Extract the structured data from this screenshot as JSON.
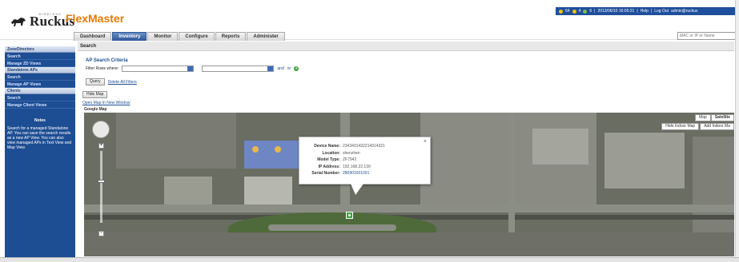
{
  "header": {
    "logo_text": "Ruckus",
    "logo_sub": "WIRELESS",
    "app_title": "FlexMaster",
    "status": {
      "counts": [
        "64",
        "4",
        "6"
      ],
      "datetime": "2013/06/10 16:05:21",
      "help": "Help",
      "logout": "Log Out",
      "user": "admin@ruckus"
    },
    "search_placeholder": "MAC or IP or Name"
  },
  "tabs": [
    {
      "label": "Dashboard"
    },
    {
      "label": "Inventory"
    },
    {
      "label": "Monitor"
    },
    {
      "label": "Configure"
    },
    {
      "label": "Reports"
    },
    {
      "label": "Administer"
    }
  ],
  "sidebar": {
    "sections": [
      {
        "title": "ZoneDirectors",
        "items": [
          "Search",
          "Manage ZD Views"
        ]
      },
      {
        "title": "Standalone APs",
        "items": [
          "Search",
          "Manage AP Views"
        ]
      },
      {
        "title": "Clients",
        "items": [
          "Search",
          "Manage Client Views"
        ]
      }
    ],
    "notes_title": "Notes",
    "notes_text": "Search for a managed Standalone AP. You can save the search results as a new AP View. You can also view managed APs in Text View and Map View."
  },
  "main": {
    "section_title": "Search",
    "criteria_title": "AP Search Criteria",
    "filter_label": "Filter Rows where:",
    "and_label": "and",
    "or_label": "or",
    "add_icon_label": "+",
    "query_button": "Query",
    "clear_filters_link": "Delete All Filters",
    "hide_map_button": "Hide Map",
    "open_map_link": "Open Map In New Window",
    "google_map_label": "Google Map"
  },
  "map": {
    "map_button": "Map",
    "satellite_button": "Satellite",
    "hide_indoor": "Hide Indoor Map",
    "add_indoor": "Add Indoor Ma",
    "zoom_in": "+",
    "zoom_out": "-",
    "close": "×",
    "info": {
      "device_name_label": "Device Name:",
      "device_name_value": "2343431432214314321",
      "location_label": "Location:",
      "location_value": "shenzhen",
      "model_type_label": "Model Type:",
      "model_type_value": "ZF7942",
      "ip_label": "IP Address:",
      "ip_value": "192.168.22.139",
      "serial_label": "Serial Number:",
      "serial_value": "280901001001"
    }
  }
}
